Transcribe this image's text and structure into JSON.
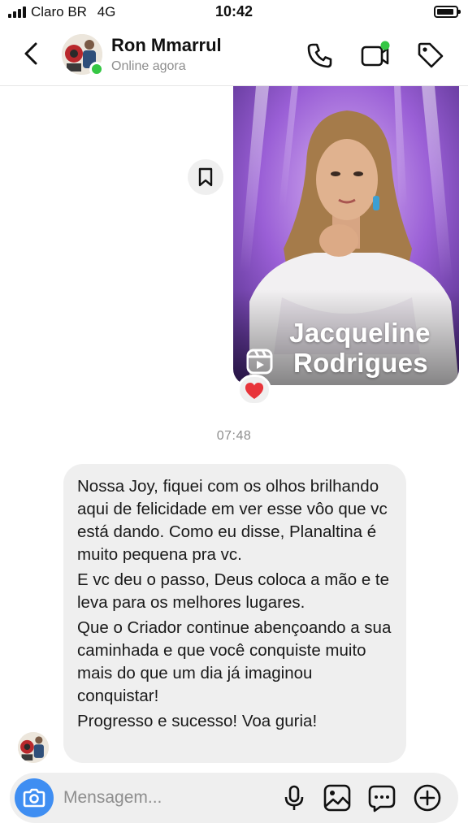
{
  "status_bar": {
    "carrier": "Claro BR",
    "network": "4G",
    "time": "10:42",
    "signal_bars": 4,
    "battery_level": 0.8
  },
  "header": {
    "contact_name": "Ron Mmarrul",
    "contact_status": "Online agora",
    "icons": [
      "back-chevron-icon",
      "phone-icon",
      "video-call-icon",
      "tag-icon"
    ],
    "online_color": "#35c744"
  },
  "reel": {
    "caption_line1": "Jacqueline",
    "caption_line2": "Rodrigues",
    "reaction": "❤️",
    "icons": [
      "reels-icon",
      "bookmark-icon"
    ]
  },
  "conversation": {
    "timestamp": "07:48",
    "message": {
      "paragraphs": [
        "Nossa Joy, fiquei com os olhos brilhando aqui de felicidade em ver esse vôo que vc está dando. Como eu disse, Planaltina é muito pequena pra vc.",
        "E vc deu o passo, Deus coloca a mão e te leva para os melhores lugares.",
        "Que o Criador continue abençoando a sua caminhada e que você conquiste muito mais do que um dia já imaginou conquistar!",
        "Progresso e sucesso!  Voa guria!"
      ]
    }
  },
  "composer": {
    "placeholder": "Mensagem...",
    "icons": [
      "camera-icon",
      "microphone-icon",
      "gallery-icon",
      "sticker-icon",
      "plus-icon"
    ],
    "camera_color": "#3f8ef2"
  }
}
